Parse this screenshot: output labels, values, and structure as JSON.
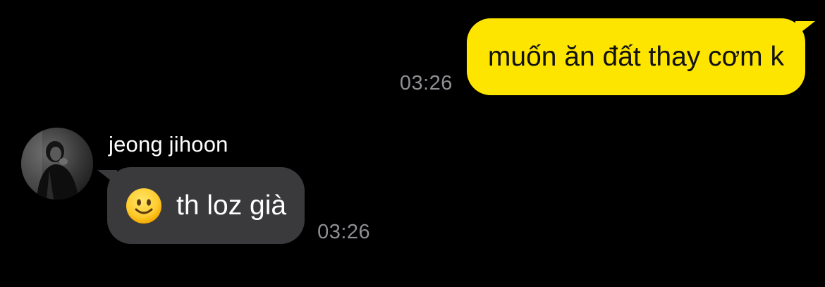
{
  "conversation": {
    "messages": [
      {
        "direction": "outgoing",
        "text": "muốn ăn đất thay cơm k",
        "time": "03:26",
        "bubble_color": "#FEE500"
      },
      {
        "direction": "incoming",
        "sender": "jeong jihoon",
        "emoji_icon": "slightly-smiling-face-icon",
        "text": "th loz già",
        "time": "03:26",
        "bubble_color": "#3A3A3C",
        "avatar_icon": "profile-photo-avatar"
      }
    ]
  },
  "theme": {
    "background": "#000000",
    "timestamp_color": "#8E8E93"
  }
}
